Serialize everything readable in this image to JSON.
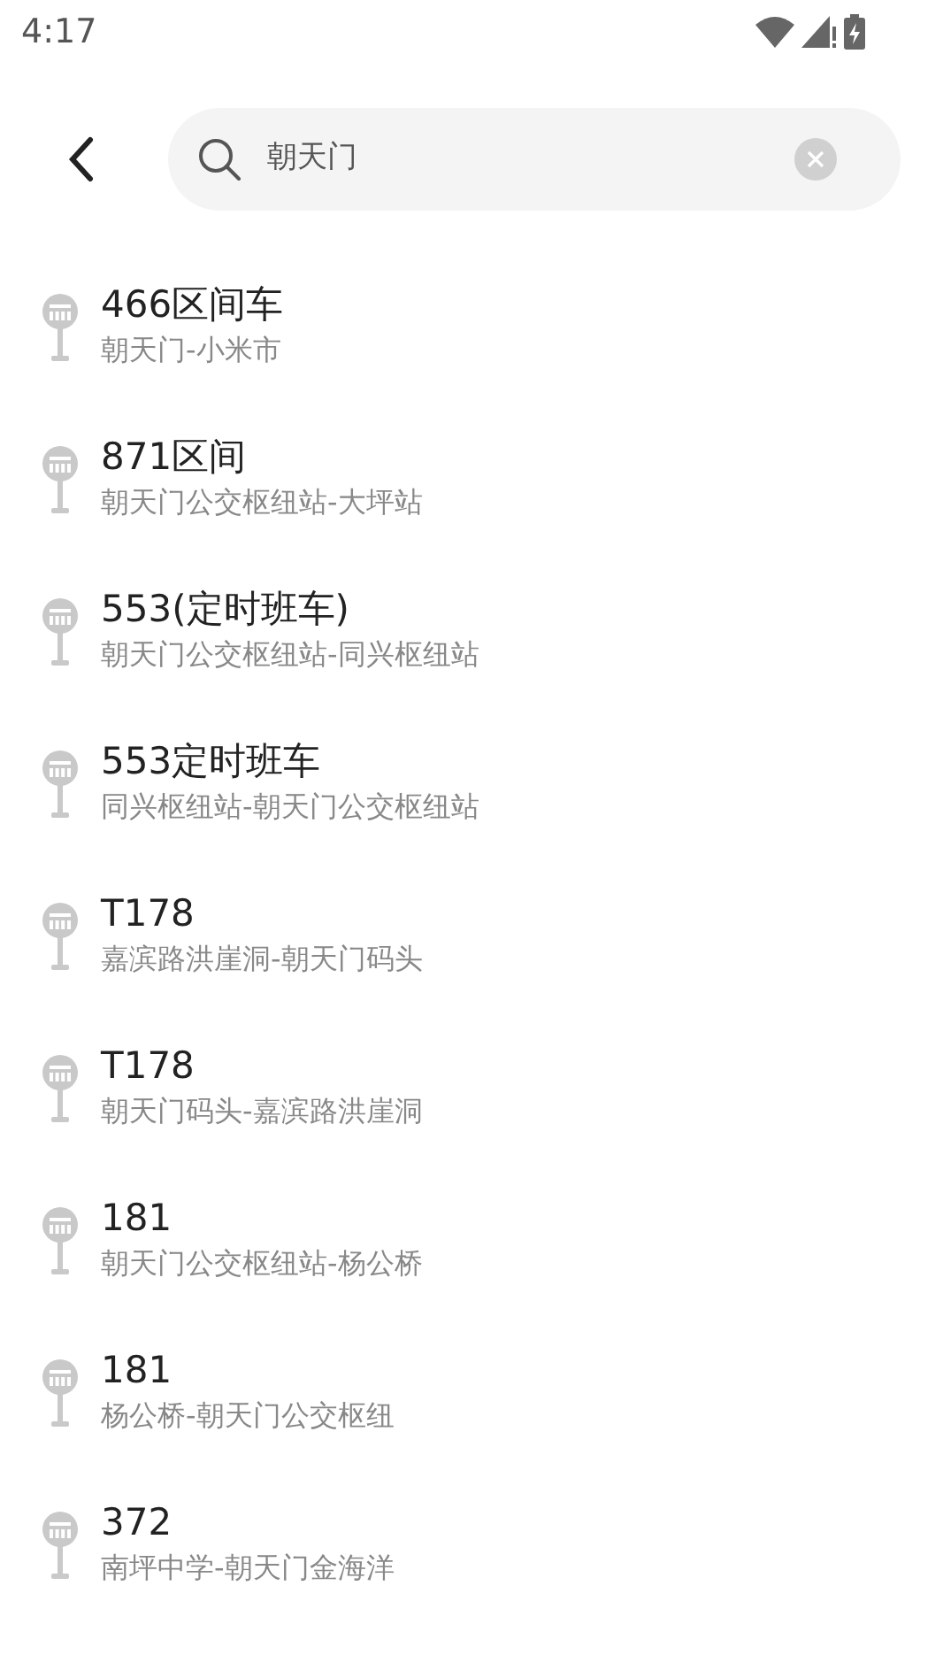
{
  "status_bar": {
    "time": "4:17"
  },
  "search": {
    "value": "朝天门"
  },
  "results": [
    {
      "title": "466区间车",
      "route": "朝天门-小米市"
    },
    {
      "title": "871区间",
      "route": "朝天门公交枢纽站-大坪站"
    },
    {
      "title": "553(定时班车)",
      "route": "朝天门公交枢纽站-同兴枢纽站"
    },
    {
      "title": "553定时班车",
      "route": "同兴枢纽站-朝天门公交枢纽站"
    },
    {
      "title": "T178",
      "route": "嘉滨路洪崖洞-朝天门码头"
    },
    {
      "title": "T178",
      "route": "朝天门码头-嘉滨路洪崖洞"
    },
    {
      "title": "181",
      "route": "朝天门公交枢纽站-杨公桥"
    },
    {
      "title": "181",
      "route": "杨公桥-朝天门公交枢纽"
    },
    {
      "title": "372",
      "route": "南坪中学-朝天门金海洋"
    }
  ]
}
